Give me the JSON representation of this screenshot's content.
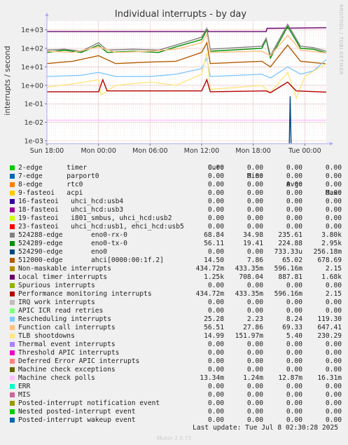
{
  "chart_data": {
    "type": "line",
    "title": "Individual interrupts - by day",
    "ylabel": "interrupts / second",
    "y_scale": "log",
    "ylim": [
      0.0007,
      3000
    ],
    "y_ticks": [
      {
        "value": 1000,
        "label": "1e+03"
      },
      {
        "value": 100,
        "label": "1e+02"
      },
      {
        "value": 10,
        "label": "1e+01"
      },
      {
        "value": 1,
        "label": "1e+00"
      },
      {
        "value": 0.1,
        "label": "1e-01"
      },
      {
        "value": 0.01,
        "label": "1e-02"
      },
      {
        "value": 0.001,
        "label": "1e-03"
      }
    ],
    "x_unit": "hours from Sun 18:00",
    "xlim": [
      0,
      32.5
    ],
    "x_ticks": [
      {
        "value": 0,
        "label": "Sun 18:00"
      },
      {
        "value": 6,
        "label": "Mon 00:00"
      },
      {
        "value": 12,
        "label": "Mon 06:00"
      },
      {
        "value": 18,
        "label": "Mon 12:00"
      },
      {
        "value": 24,
        "label": "Mon 18:00"
      },
      {
        "value": 30,
        "label": "Tue 00:00"
      }
    ],
    "grid": true,
    "columns": [
      "Cur:",
      "Min:",
      "Avg:",
      "Max:"
    ],
    "series": [
      {
        "name": "2-edge      timer",
        "color": "#00cc00",
        "cur": "0.00",
        "min": "0.00",
        "avg": "0.00",
        "max": "0.00"
      },
      {
        "name": "7-edge      parport0",
        "color": "#0066b3",
        "cur": "0.00",
        "min": "0.00",
        "avg": "0.00",
        "max": "0.00"
      },
      {
        "name": "8-edge      rtc0",
        "color": "#ff8000",
        "cur": "0.00",
        "min": "0.00",
        "avg": "0.00",
        "max": "0.00"
      },
      {
        "name": "9-fasteoi   acpi",
        "color": "#ffcc00",
        "cur": "0.00",
        "min": "0.00",
        "avg": "0.00",
        "max": "0.00"
      },
      {
        "name": "16-fasteoi   uhci_hcd:usb4",
        "color": "#330099",
        "cur": "0.00",
        "min": "0.00",
        "avg": "0.00",
        "max": "0.00"
      },
      {
        "name": "18-fasteoi   uhci_hcd:usb3",
        "color": "#990099",
        "cur": "0.00",
        "min": "0.00",
        "avg": "0.00",
        "max": "0.00"
      },
      {
        "name": "19-fasteoi   i801_smbus, uhci_hcd:usb2",
        "color": "#ccff00",
        "cur": "0.00",
        "min": "0.00",
        "avg": "0.00",
        "max": "0.00"
      },
      {
        "name": "23-fasteoi   uhci_hcd:usb1, ehci_hcd:usb5",
        "color": "#ff0000",
        "cur": "0.00",
        "min": "0.00",
        "avg": "0.00",
        "max": "0.00"
      },
      {
        "name": "524288-edge       eno0-rx-0",
        "color": "#808080",
        "cur": "68.84",
        "min": "34.98",
        "avg": "235.61",
        "max": "3.80k"
      },
      {
        "name": "524289-edge       eno0-tx-0",
        "color": "#008f00",
        "cur": "56.11",
        "min": "19.41",
        "avg": "224.88",
        "max": "2.95k"
      },
      {
        "name": "524290-edge       eno0",
        "color": "#00487d",
        "cur": "0.00",
        "min": "0.00",
        "avg": "733.33u",
        "max": "256.18m"
      },
      {
        "name": "512000-edge       ahci[0000:00:1f.2]",
        "color": "#b35a00",
        "cur": "14.50",
        "min": "7.86",
        "avg": "65.02",
        "max": "678.69"
      },
      {
        "name": "Non-maskable interrupts",
        "color": "#b38f00",
        "cur": "434.72m",
        "min": "433.35m",
        "avg": "596.16m",
        "max": "2.15"
      },
      {
        "name": "Local timer interrupts",
        "color": "#6b006b",
        "cur": "1.25k",
        "min": "708.04",
        "avg": "887.81",
        "max": "1.68k"
      },
      {
        "name": "Spurious interrupts",
        "color": "#8fb300",
        "cur": "0.00",
        "min": "0.00",
        "avg": "0.00",
        "max": "0.00"
      },
      {
        "name": "Performance monitoring interrupts",
        "color": "#b30000",
        "cur": "434.72m",
        "min": "433.35m",
        "avg": "596.16m",
        "max": "2.15"
      },
      {
        "name": "IRQ work interrupts",
        "color": "#bebebe",
        "cur": "0.00",
        "min": "0.00",
        "avg": "0.00",
        "max": "0.00"
      },
      {
        "name": "APIC ICR read retries",
        "color": "#80ff80",
        "cur": "0.00",
        "min": "0.00",
        "avg": "0.00",
        "max": "0.00"
      },
      {
        "name": "Rescheduling interrupts",
        "color": "#80c9ff",
        "cur": "25.28",
        "min": "2.23",
        "avg": "8.24",
        "max": "119.30"
      },
      {
        "name": "Function call interrupts",
        "color": "#ffc080",
        "cur": "56.51",
        "min": "27.86",
        "avg": "69.33",
        "max": "647.41"
      },
      {
        "name": "TLB shootdowns",
        "color": "#ffe680",
        "cur": "14.99",
        "min": "151.97m",
        "avg": "5.40",
        "max": "230.29"
      },
      {
        "name": "Thermal event interrupts",
        "color": "#aa80ff",
        "cur": "0.00",
        "min": "0.00",
        "avg": "0.00",
        "max": "0.00"
      },
      {
        "name": "Threshold APIC interrupts",
        "color": "#ee00cc",
        "cur": "0.00",
        "min": "0.00",
        "avg": "0.00",
        "max": "0.00"
      },
      {
        "name": "Deferred Error APIC interrupts",
        "color": "#ff8080",
        "cur": "0.00",
        "min": "0.00",
        "avg": "0.00",
        "max": "0.00"
      },
      {
        "name": "Machine check exceptions",
        "color": "#666600",
        "cur": "0.00",
        "min": "0.00",
        "avg": "0.00",
        "max": "0.00"
      },
      {
        "name": "Machine check polls",
        "color": "#ffbfff",
        "cur": "13.34m",
        "min": "1.24m",
        "avg": "12.87m",
        "max": "16.31m"
      },
      {
        "name": "ERR",
        "color": "#00ffcc",
        "cur": "0.00",
        "min": "0.00",
        "avg": "0.00",
        "max": "0.00"
      },
      {
        "name": "MIS",
        "color": "#cc6699",
        "cur": "0.00",
        "min": "0.00",
        "avg": "0.00",
        "max": "0.00"
      },
      {
        "name": "Posted-interrupt notification event",
        "color": "#999900",
        "cur": "0.00",
        "min": "0.00",
        "avg": "0.00",
        "max": "0.00"
      },
      {
        "name": "Nested posted-interrupt event",
        "color": "#00cc00",
        "cur": "0.00",
        "min": "0.00",
        "avg": "0.00",
        "max": "0.00"
      },
      {
        "name": "Posted-interrupt wakeup event",
        "color": "#0066b3",
        "cur": "0.00",
        "min": "0.00",
        "avg": "0.00",
        "max": "0.00"
      }
    ],
    "plot_lines": [
      {
        "series": "Local timer interrupts",
        "color": "#6b006b",
        "points": [
          [
            0,
            800
          ],
          [
            18.5,
            800
          ],
          [
            18.6,
            1100
          ],
          [
            18.8,
            800
          ],
          [
            25.5,
            800
          ],
          [
            25.6,
            1200
          ],
          [
            32.5,
            1300
          ]
        ]
      },
      {
        "series": "eno0-tx-0",
        "color": "#008f00",
        "points": [
          [
            0,
            60
          ],
          [
            2,
            80
          ],
          [
            4,
            60
          ],
          [
            6,
            150
          ],
          [
            7,
            60
          ],
          [
            10,
            70
          ],
          [
            13,
            60
          ],
          [
            15,
            120
          ],
          [
            18,
            300
          ],
          [
            18.6,
            1000
          ],
          [
            19,
            70
          ],
          [
            25,
            100
          ],
          [
            25.5,
            300
          ],
          [
            26,
            30
          ],
          [
            28,
            1500
          ],
          [
            29.5,
            100
          ],
          [
            31,
            90
          ],
          [
            32.5,
            56
          ]
        ]
      },
      {
        "series": "eno0-rx-0",
        "color": "#808080",
        "points": [
          [
            0,
            80
          ],
          [
            2,
            90
          ],
          [
            4,
            70
          ],
          [
            6,
            200
          ],
          [
            7,
            80
          ],
          [
            10,
            90
          ],
          [
            13,
            80
          ],
          [
            15,
            150
          ],
          [
            18,
            400
          ],
          [
            18.6,
            1200
          ],
          [
            19,
            90
          ],
          [
            25,
            130
          ],
          [
            25.5,
            350
          ],
          [
            26,
            40
          ],
          [
            28,
            2000
          ],
          [
            29.5,
            130
          ],
          [
            31,
            110
          ],
          [
            32.5,
            69
          ]
        ]
      },
      {
        "series": "Function call interrupts",
        "color": "#ffc080",
        "points": [
          [
            0,
            70
          ],
          [
            3,
            60
          ],
          [
            6,
            120
          ],
          [
            8,
            60
          ],
          [
            12,
            70
          ],
          [
            15,
            90
          ],
          [
            18,
            200
          ],
          [
            18.6,
            600
          ],
          [
            19,
            60
          ],
          [
            25,
            70
          ],
          [
            26,
            40
          ],
          [
            28,
            500
          ],
          [
            29.5,
            80
          ],
          [
            32.5,
            56
          ]
        ]
      },
      {
        "series": "ahci[0000:00:1f.2]",
        "color": "#b35a00",
        "points": [
          [
            0,
            15
          ],
          [
            3,
            20
          ],
          [
            6,
            40
          ],
          [
            8,
            15
          ],
          [
            12,
            18
          ],
          [
            15,
            20
          ],
          [
            18,
            60
          ],
          [
            18.6,
            200
          ],
          [
            19,
            15
          ],
          [
            25,
            20
          ],
          [
            26,
            10
          ],
          [
            28,
            150
          ],
          [
            29.5,
            20
          ],
          [
            32.5,
            14.5
          ]
        ]
      },
      {
        "series": "Rescheduling interrupts",
        "color": "#80c9ff",
        "points": [
          [
            0,
            3
          ],
          [
            4,
            3.5
          ],
          [
            6,
            5
          ],
          [
            8,
            3
          ],
          [
            12,
            3
          ],
          [
            15,
            4
          ],
          [
            18,
            8
          ],
          [
            18.6,
            30
          ],
          [
            19,
            3
          ],
          [
            25,
            4
          ],
          [
            26,
            2.5
          ],
          [
            28,
            10
          ],
          [
            29.5,
            4
          ],
          [
            31,
            6
          ],
          [
            32.5,
            25
          ]
        ]
      },
      {
        "series": "TLB shootdowns",
        "color": "#ffe680",
        "points": [
          [
            0,
            0.8
          ],
          [
            3,
            1.2
          ],
          [
            6,
            2
          ],
          [
            6.3,
            0.3
          ],
          [
            8,
            1
          ],
          [
            12,
            1.5
          ],
          [
            15,
            1
          ],
          [
            18,
            4
          ],
          [
            18.6,
            60
          ],
          [
            19,
            0.6
          ],
          [
            25,
            1
          ],
          [
            26,
            0.4
          ],
          [
            28,
            5
          ],
          [
            29,
            0.2
          ],
          [
            30,
            3
          ],
          [
            32.5,
            15
          ]
        ]
      },
      {
        "series": "Performance monitoring interrupts",
        "color": "#b30000",
        "points": [
          [
            0,
            0.45
          ],
          [
            6,
            0.45
          ],
          [
            6.5,
            2
          ],
          [
            7,
            0.5
          ],
          [
            18,
            0.5
          ],
          [
            18.6,
            2
          ],
          [
            19,
            0.45
          ],
          [
            25.5,
            0.5
          ],
          [
            26,
            0.4
          ],
          [
            28,
            1.5
          ],
          [
            29,
            0.5
          ],
          [
            32.5,
            0.43
          ]
        ]
      },
      {
        "series": "Machine check polls",
        "color": "#ffbfff",
        "points": [
          [
            0,
            0.013
          ],
          [
            32.5,
            0.013
          ]
        ]
      },
      {
        "series": "eno0",
        "color": "#00487d",
        "points": [
          [
            28.2,
            0.0007
          ],
          [
            28.3,
            0.256
          ],
          [
            28.4,
            0.0007
          ]
        ]
      }
    ]
  },
  "footer": {
    "last_update": "Last update: Tue Jul  8 02:30:28 2025",
    "generator": "Munin 2.0.73"
  },
  "watermark": "RRDTOOL / TOBI OETIKER"
}
